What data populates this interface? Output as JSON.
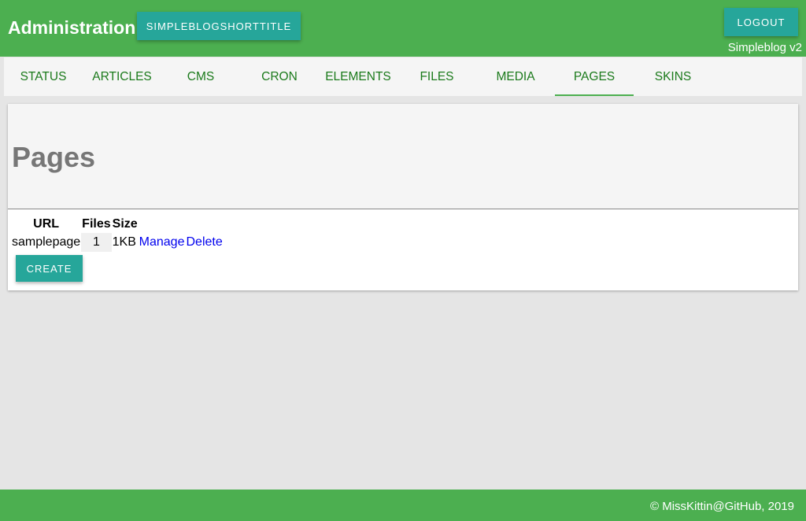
{
  "header": {
    "title": "Administration",
    "blog_button": "SIMPLEBLOGSHORTTITLE",
    "logout_button": "LOGOUT",
    "version": "Simpleblog v2"
  },
  "tabs": [
    {
      "label": "STATUS",
      "active": false
    },
    {
      "label": "ARTICLES",
      "active": false
    },
    {
      "label": "CMS",
      "active": false
    },
    {
      "label": "CRON",
      "active": false
    },
    {
      "label": "ELEMENTS",
      "active": false
    },
    {
      "label": "FILES",
      "active": false
    },
    {
      "label": "MEDIA",
      "active": false
    },
    {
      "label": "PAGES",
      "active": true
    },
    {
      "label": "SKINS",
      "active": false
    }
  ],
  "main": {
    "title": "Pages",
    "table": {
      "headers": [
        "URL",
        "Files",
        "Size"
      ],
      "rows": [
        {
          "url": "samplepage",
          "files": "1",
          "size": "1KB",
          "manage": "Manage",
          "delete": "Delete"
        }
      ]
    },
    "create_button": "CREATE"
  },
  "footer": {
    "text": "© MissKittin@GitHub, 2019"
  },
  "colors": {
    "header_bg": "#4caf50",
    "button_bg": "#26a69a",
    "tab_text": "#1b7a1b",
    "link": "#0000ee"
  }
}
